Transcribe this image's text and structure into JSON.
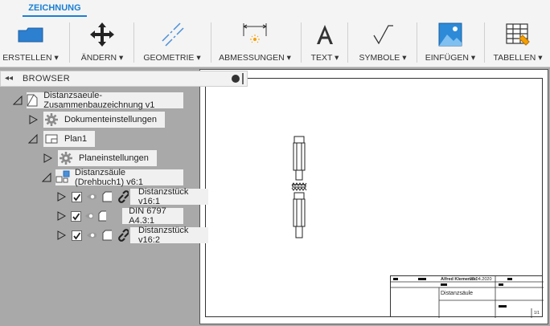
{
  "ribbon": {
    "active_tab": "ZEICHNUNG",
    "groups": [
      {
        "label": "ERSTELLEN ▾",
        "icon": "sheet-create-icon"
      },
      {
        "label": "ÄNDERN ▾",
        "icon": "move-icon"
      },
      {
        "label": "GEOMETRIE ▾",
        "icon": "centerline-icon"
      },
      {
        "label": "ABMESSUNGEN ▾",
        "icon": "dimension-icon"
      },
      {
        "label": "TEXT ▾",
        "icon": "text-icon"
      },
      {
        "label": "SYMBOLE ▾",
        "icon": "surface-symbol-icon"
      },
      {
        "label": "EINFÜGEN ▾",
        "icon": "insert-image-icon"
      },
      {
        "label": "TABELLEN ▾",
        "icon": "table-icon"
      }
    ]
  },
  "browser": {
    "title": "BROWSER",
    "items": [
      {
        "label": "Distanzsaeule-Zusammenbauzeichnung v1",
        "icon": "drawing-icon"
      },
      {
        "label": "Dokumenteinstellungen",
        "icon": "gear-icon"
      },
      {
        "label": "Plan1",
        "icon": "sheet-icon"
      },
      {
        "label": "Planeinstellungen",
        "icon": "gear-icon"
      },
      {
        "label": "Distanzsäule (Drehbuch1) v6:1",
        "icon": "view-icon"
      },
      {
        "label": "Distanzstück v16:1",
        "icon": "link-icon"
      },
      {
        "label": "DIN 6797 A4.3:1",
        "icon": "component-icon"
      },
      {
        "label": "Distanzstück v16:2",
        "icon": "link-icon"
      }
    ]
  },
  "title_block": {
    "author": "Alfred Klemenski",
    "date": "25.04.2020",
    "title": "Distanzsäule",
    "sheet": "1/1"
  }
}
